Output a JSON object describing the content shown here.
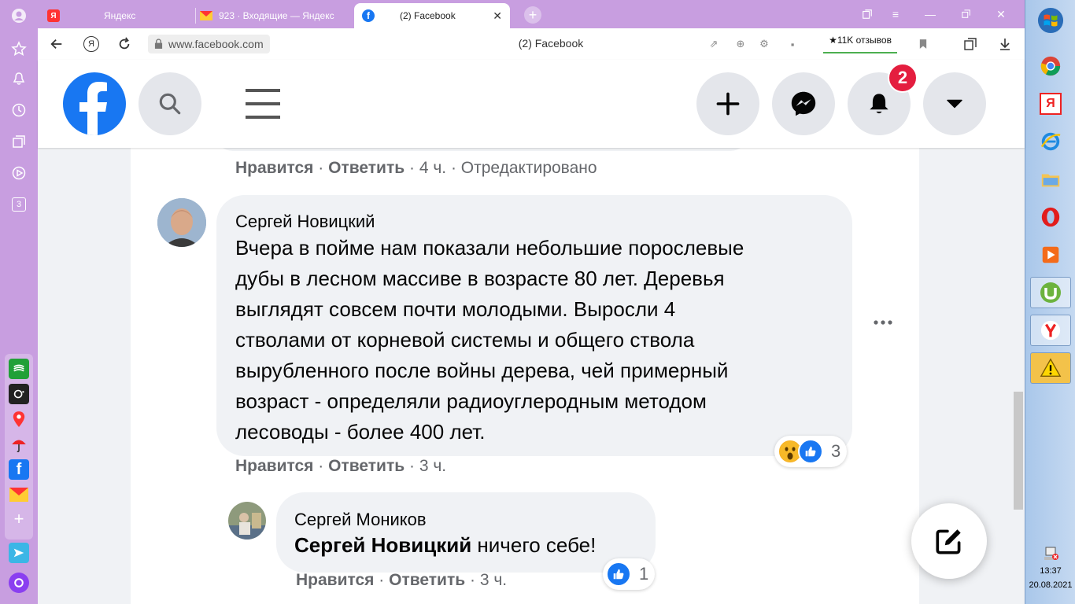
{
  "browser": {
    "tabs": [
      {
        "label": "Яндекс",
        "icon": "yandex-icon"
      },
      {
        "label": "923 · Входящие — Яндекс",
        "icon": "mail-icon"
      },
      {
        "label": "(2) Facebook",
        "icon": "facebook-icon"
      }
    ],
    "url": "www.facebook.com",
    "page_title": "(2) Facebook",
    "sidebar_badge": "3",
    "reviews": "★11K отзывов"
  },
  "fb": {
    "notification_count": "2"
  },
  "comments": {
    "prev_meta": {
      "like": "Нравится",
      "sep1": " · ",
      "reply": "Ответить",
      "rest": " · 4 ч. · Отредактировано"
    },
    "main": {
      "author": "Сергей Новицкий",
      "lines": [
        "Вчера в пойме нам показали небольшие порослевые",
        "дубы в лесном массиве в возрасте 80 лет. Деревья",
        "выглядят совсем почти молодыми. Выросли 4",
        "стволами от корневой системы и общего ствола",
        "вырубленного после войны дерева, чей примерный",
        "возраст - определяли радиоуглеродным методом",
        "лесоводы - более 400 лет."
      ],
      "reaction_count": "3",
      "meta": {
        "like": "Нравится",
        "sep1": " · ",
        "reply": "Ответить",
        "rest": " · 3 ч."
      }
    },
    "reply": {
      "author": "Сергей Моников",
      "mention": "Сергей Новицкий",
      "text": " ничего себе!",
      "reaction_count": "1",
      "meta": {
        "like": "Нравится",
        "sep1": " · ",
        "reply": "Ответить",
        "rest": " · 3 ч."
      }
    }
  },
  "taskbar": {
    "time": "13:37",
    "date": "20.08.2021"
  },
  "colors": {
    "browser_purple": "#c89ee0",
    "fb_blue": "#1877f2",
    "text_secondary": "#65676b"
  }
}
